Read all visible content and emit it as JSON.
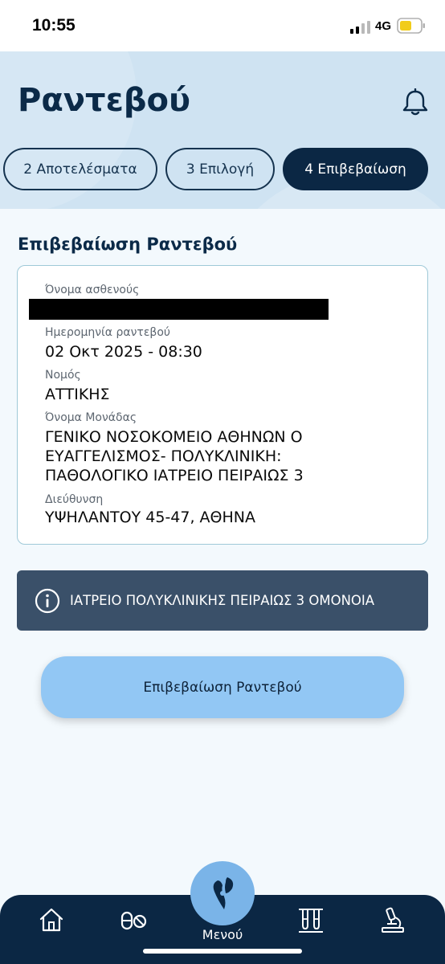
{
  "status": {
    "time": "10:55",
    "network": "4G"
  },
  "header": {
    "title": "Ραντεβού",
    "steps": [
      {
        "label": "2 Αποτελέσματα",
        "active": false
      },
      {
        "label": "3 Επιλογή",
        "active": false
      },
      {
        "label": "4 Επιβεβαίωση",
        "active": true
      }
    ]
  },
  "section": {
    "title": "Επιβεβαίωση Ραντεβού"
  },
  "card": {
    "patient_label": "Όνομα ασθενούς",
    "date_label": "Ημερομηνία ραντεβού",
    "date_value": "02 Οκτ 2025 - 08:30",
    "county_label": "Νομός",
    "county_value": "ΑΤΤΙΚΗΣ",
    "unit_label": "Όνομα Μονάδας",
    "unit_lines": [
      "ΓΕΝΙΚΟ ΝΟΣΟΚΟΜΕΙΟ ΑΘΗΝΩΝ Ο",
      "ΕΥΑΓΓΕΛΙΣΜΟΣ- ΠΟΛΥΚΛΙΝΙΚΗ:",
      "ΠΑΘΟΛΟΓΙΚΟ ΙΑΤΡΕΙΟ  ΠΕΙΡΑΙΩΣ 3"
    ],
    "address_label": "Διεύθυνση",
    "address_value": "ΥΨΗΛΑΝΤΟΥ 45-47, ΑΘΗΝΑ"
  },
  "info": {
    "text": "ΙΑΤΡΕΙΟ ΠΟΛΥΚΛΙΝΙΚΗΣ ΠΕΙΡΑΙΩΣ 3 ΟΜΟΝΟΙΑ",
    "icon": "info-icon"
  },
  "confirm_button": {
    "label": "Επιβεβαίωση Ραντεβού"
  },
  "nav": {
    "menu_label": "Μενού",
    "icons": [
      "home-icon",
      "pills-icon",
      "menu-logo-icon",
      "test-tubes-icon",
      "microscope-icon"
    ]
  },
  "colors": {
    "navy": "#0b2744",
    "header_bg": "#cfe3f2",
    "button_bg": "#92c7f4",
    "banner_bg": "#3a5069",
    "menu_circle": "#7ab4e8",
    "card_border": "#9fc9d8"
  }
}
